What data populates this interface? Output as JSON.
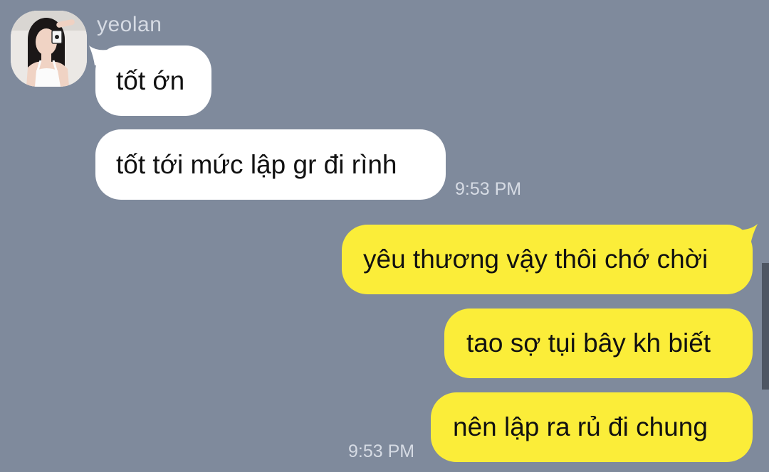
{
  "chat": {
    "sender": "yeolan",
    "incoming": [
      {
        "text": "tốt ớn"
      },
      {
        "text": "tốt tới mức lập gr đi rình"
      }
    ],
    "incoming_time": "9:53 PM",
    "outgoing": [
      {
        "text": "yêu thương vậy thôi chớ chời"
      },
      {
        "text": "tao sợ tụi bây kh biết"
      },
      {
        "text": "nên lập ra rủ đi chung"
      }
    ],
    "outgoing_time": "9:53 PM"
  },
  "colors": {
    "background": "#7f8a9c",
    "incoming_bubble": "#ffffff",
    "outgoing_bubble": "#fbed39",
    "meta_text": "#d6dbe4"
  },
  "icons": {
    "avatar": "profile-photo"
  }
}
